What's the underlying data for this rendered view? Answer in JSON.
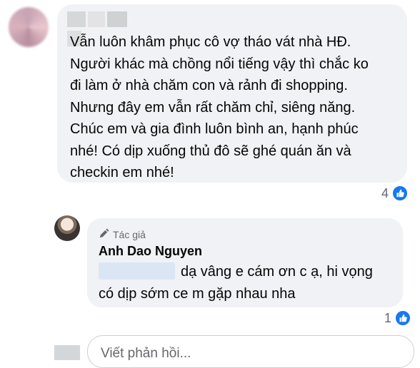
{
  "comment": {
    "text": "Vẫn luôn khâm phục cô vợ tháo vát nhà HĐ.\nNgười khác mà chồng nổi tiếng vậy thì chắc ko\nđi làm ở nhà chăm con và rảnh đi shopping.\nNhưng đây em vẫn rất chăm chỉ, siêng năng.\nChúc em và gia đình luôn bình an, hạnh phúc\nnhé! Có dịp xuống thủ đô sẽ ghé quán ăn và\ncheckin em nhé!",
    "like_count": "4"
  },
  "reply": {
    "badge": "Tác giả",
    "author": "Anh Dao Nguyen",
    "text": "dạ vâng e cám ơn c ạ, hi vọng\ncó dịp sớm ce m gặp nhau nha",
    "like_count": "1"
  },
  "input": {
    "placeholder": "Viết phản hồi..."
  },
  "colors": {
    "bubble": "#f0f2f5",
    "like": "#1877f2",
    "meta_text": "#65676b"
  }
}
